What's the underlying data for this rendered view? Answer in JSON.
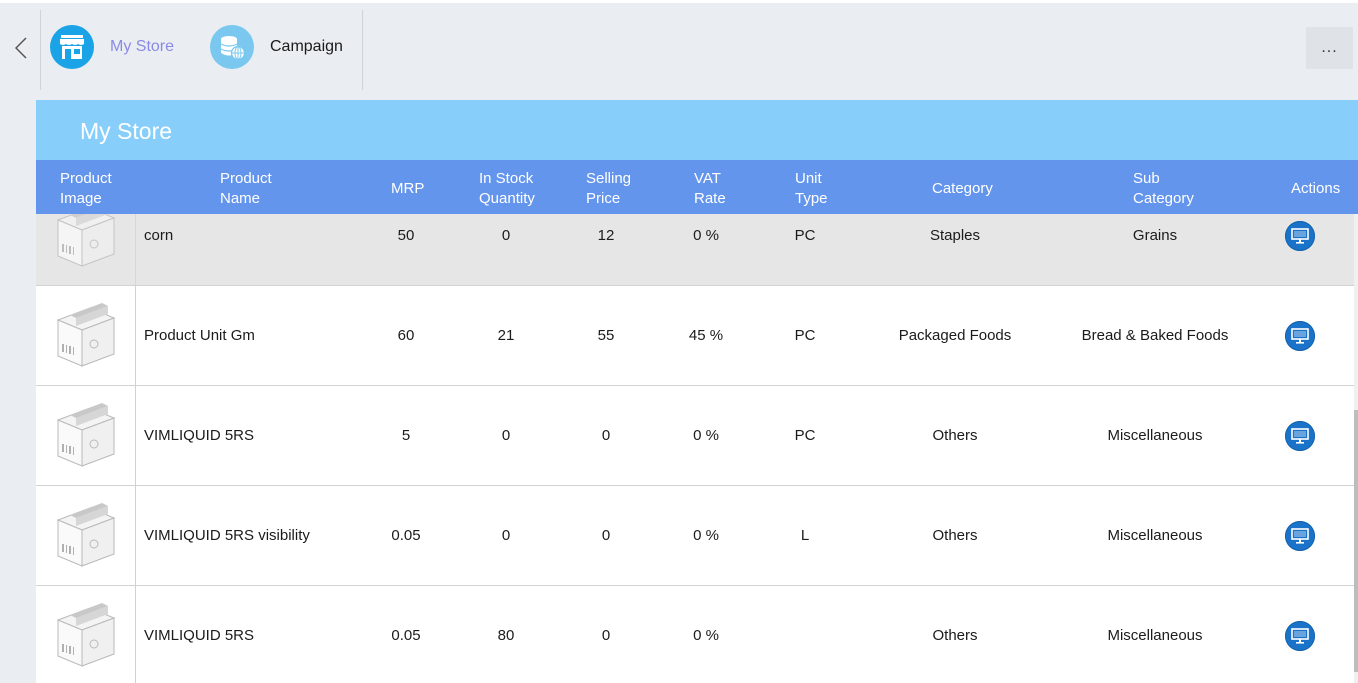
{
  "nav": {
    "back_icon": "chevron-left-icon",
    "items": [
      {
        "label": "My Store",
        "icon": "store-icon",
        "active": true
      },
      {
        "label": "Campaign",
        "icon": "database-globe-icon",
        "active": false
      }
    ],
    "more_label": "..."
  },
  "page": {
    "title": "My Store"
  },
  "table": {
    "headers": {
      "product_image": "Product\nImage",
      "product_name": "Product\nName",
      "mrp": "MRP",
      "in_stock_quantity": "In Stock\nQuantity",
      "selling_price": "Selling\nPrice",
      "vat_rate": "VAT\nRate",
      "unit_type": "Unit\nType",
      "category": "Category",
      "sub_category": "Sub\nCategory",
      "actions": "Actions"
    },
    "rows": [
      {
        "name": "corn",
        "mrp": "50",
        "qty": "0",
        "price": "12",
        "vat": "0 %",
        "unit": "PC",
        "category": "Staples",
        "sub_category": "Grains",
        "selected": true
      },
      {
        "name": "Product Unit Gm",
        "mrp": "60",
        "qty": "21",
        "price": "55",
        "vat": "45 %",
        "unit": "PC",
        "category": "Packaged Foods",
        "sub_category": "Bread & Baked Foods"
      },
      {
        "name": "VIMLIQUID 5RS",
        "mrp": "5",
        "qty": "0",
        "price": "0",
        "vat": "0 %",
        "unit": "PC",
        "category": "Others",
        "sub_category": "Miscellaneous"
      },
      {
        "name": "VIMLIQUID 5RS visibility",
        "mrp": "0.05",
        "qty": "0",
        "price": "0",
        "vat": "0 %",
        "unit": "L",
        "category": "Others",
        "sub_category": "Miscellaneous"
      },
      {
        "name": "VIMLIQUID 5RS",
        "mrp": "0.05",
        "qty": "80",
        "price": "0",
        "vat": "0 %",
        "unit": "",
        "category": "Others",
        "sub_category": "Miscellaneous"
      }
    ],
    "row_image_icon": "product-box-placeholder-icon",
    "row_action_icon": "monitor-icon"
  },
  "colors": {
    "accent": "#1aa3e6",
    "title_bar": "#87cefa",
    "header_bar": "#6495ed",
    "action_button": "#1a73c9",
    "active_nav_text": "#8a8ae6"
  }
}
